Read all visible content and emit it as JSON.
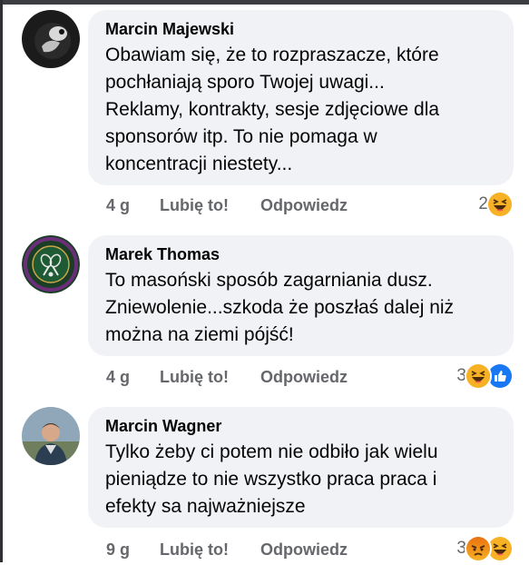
{
  "comments": [
    {
      "author": "Marcin Majewski",
      "text": "Obawiam się, że to rozpraszacze, które pochłaniają sporo Twojej uwagi... Reklamy, kontrakty, sesje zdjęciowe dla sponsorów itp.  To nie pomaga w koncentracji niestety...",
      "lines": [
        "Obawiam się, że to rozpraszacze, które",
        "pochłaniają sporo Twojej uwagi...",
        "Reklamy, kontrakty, sesje zdjęciowe dla",
        "sponsorów itp.  To nie pomaga w",
        "koncentracji niestety..."
      ],
      "time": "4 g",
      "like_label": "Lubię to!",
      "reply_label": "Odpowiedz",
      "reaction_count": "2",
      "reactions": [
        "haha"
      ]
    },
    {
      "author": "Marek Thomas",
      "lines": [
        "To masoński sposób zagarniania dusz.",
        "Zniewolenie...szkoda że poszłaś dalej niż",
        "można na ziemi pójść!"
      ],
      "time": "4 g",
      "like_label": "Lubię to!",
      "reply_label": "Odpowiedz",
      "reaction_count": "3",
      "reactions": [
        "haha",
        "like"
      ]
    },
    {
      "author": "Marcin Wagner",
      "lines": [
        "Tylko żeby ci potem nie odbiło jak wielu",
        "pieniądze to nie wszystko praca praca i",
        "efekty sa najważniejsze"
      ],
      "time": "9 g",
      "like_label": "Lubię to!",
      "reply_label": "Odpowiedz",
      "reaction_count": "3",
      "reactions": [
        "angry",
        "haha"
      ]
    }
  ],
  "avatar2_badge": "THE CHAMPIONSHIPS WIMBLEDON",
  "colors": {
    "bubble": "#f0f2f5",
    "meta": "#65676b",
    "like_blue": "#1877f2",
    "haha_yellow": "#f7b125",
    "angry_red": "#e9710f"
  }
}
